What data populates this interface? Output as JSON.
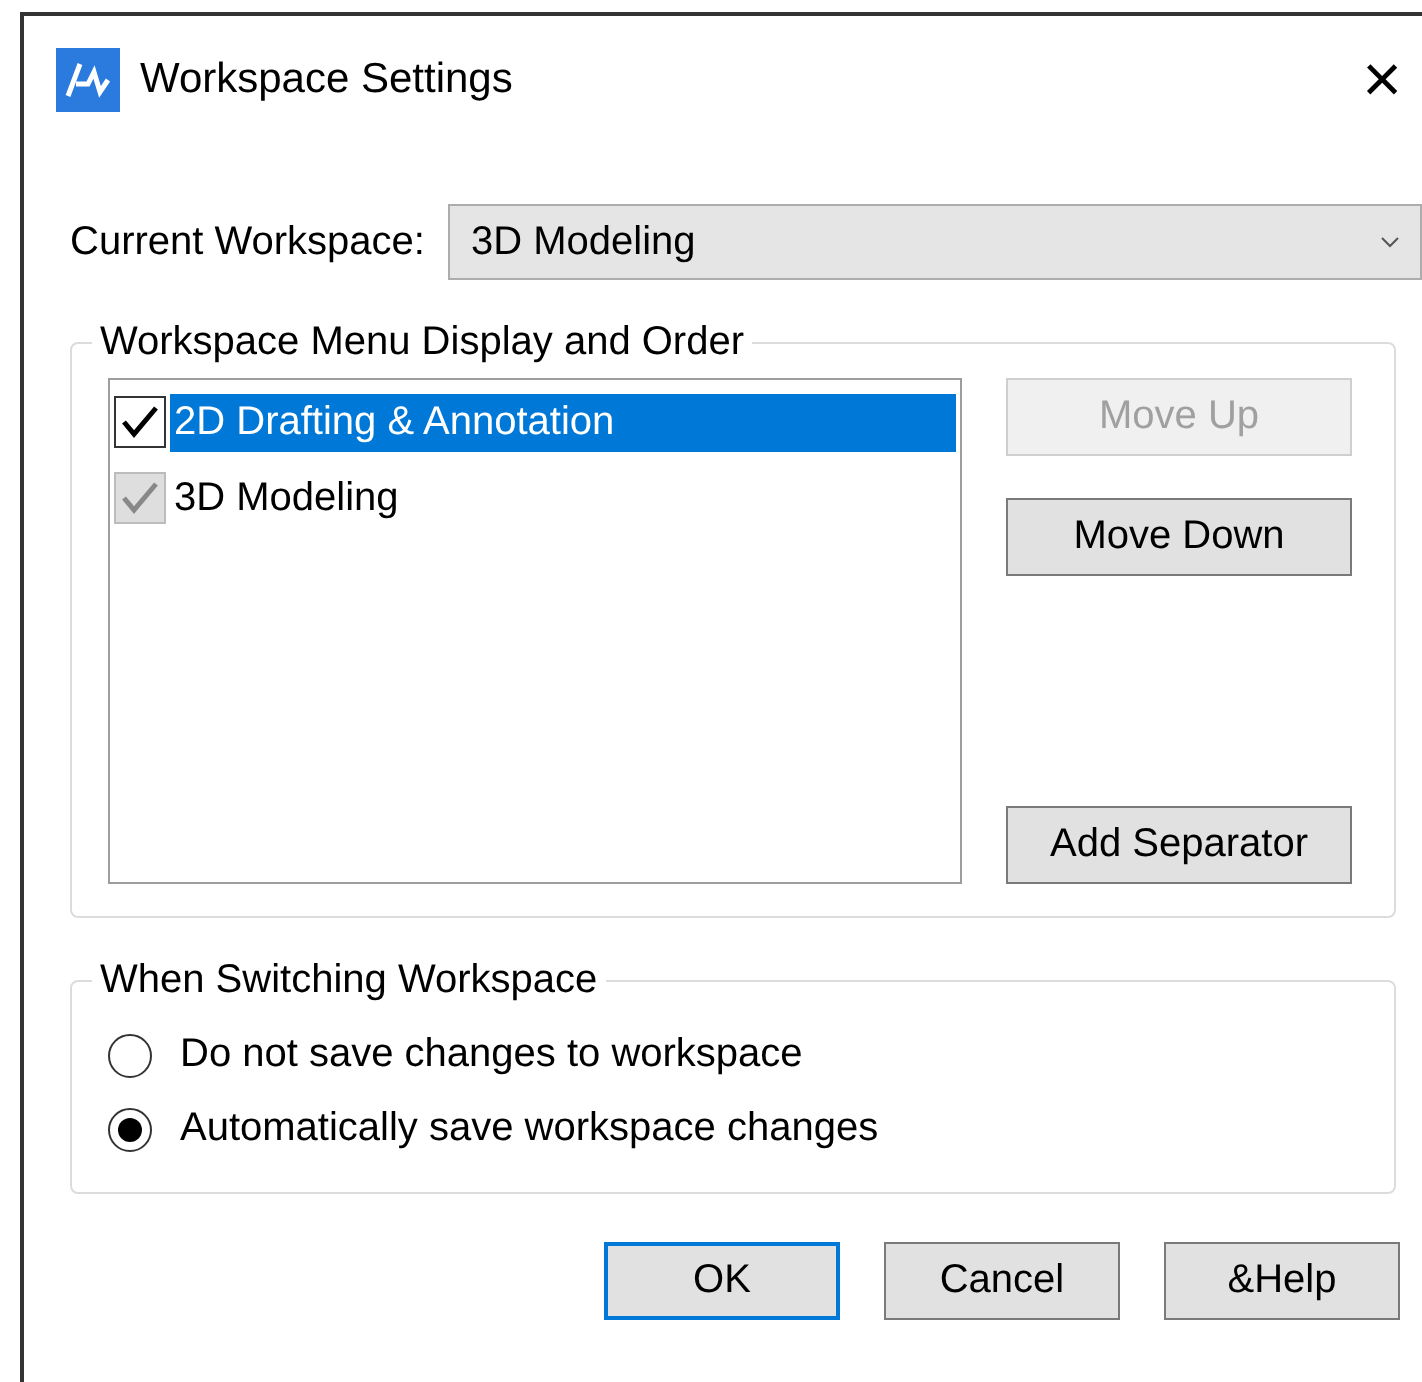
{
  "window": {
    "title": "Workspace Settings",
    "close": "×"
  },
  "current_workspace": {
    "label": "Current Workspace:",
    "value": "3D Modeling"
  },
  "menu_group": {
    "title": "Workspace Menu Display and Order",
    "items": [
      {
        "label": "2D Drafting & Annotation",
        "checked": true,
        "disabled": false,
        "selected": true
      },
      {
        "label": "3D Modeling",
        "checked": true,
        "disabled": true,
        "selected": false
      }
    ],
    "buttons": [
      {
        "label": "Move Up",
        "disabled": true
      },
      {
        "label": "Move Down",
        "disabled": false
      },
      {
        "label": "Add Separator",
        "disabled": false
      }
    ]
  },
  "switching_group": {
    "title": "When Switching Workspace",
    "options": [
      {
        "label": "Do not save changes to workspace",
        "selected": false
      },
      {
        "label": "Automatically save workspace changes",
        "selected": true
      }
    ]
  },
  "buttons": [
    {
      "label": "OK",
      "default": true
    },
    {
      "label": "Cancel",
      "default": false
    },
    {
      "label": "&Help",
      "default": false
    }
  ]
}
